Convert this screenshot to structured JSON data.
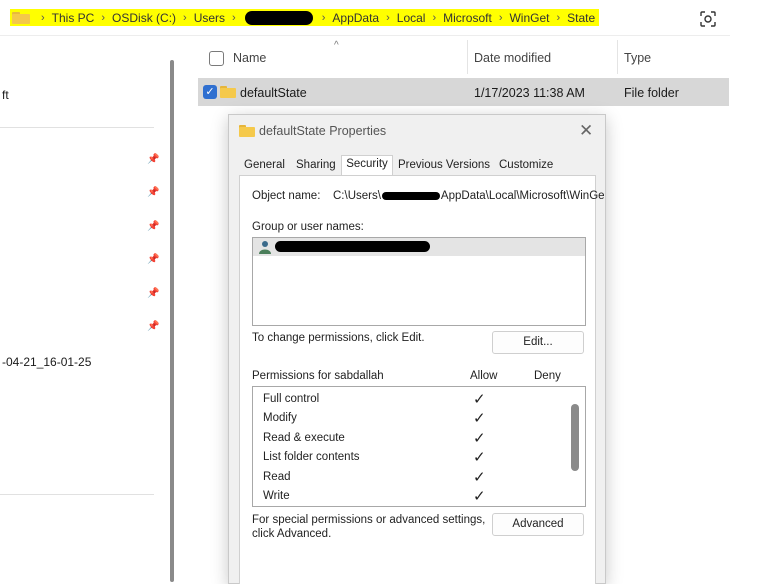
{
  "breadcrumb": {
    "items": [
      "This PC",
      "OSDisk (C:)",
      "Users",
      "AppData",
      "Local",
      "Microsoft",
      "WinGet",
      "State"
    ]
  },
  "left_pane": {
    "text1": "ft",
    "text2": "-04-21_16-01-25"
  },
  "file_list": {
    "headers": {
      "name": "Name",
      "date": "Date modified",
      "type": "Type"
    },
    "row": {
      "name": "defaultState",
      "date": "1/17/2023 11:38 AM",
      "type": "File folder"
    }
  },
  "dialog": {
    "title": "defaultState Properties",
    "tabs": [
      "General",
      "Sharing",
      "Security",
      "Previous Versions",
      "Customize"
    ],
    "object_name_label": "Object name:",
    "object_name_prefix": "C:\\Users\\",
    "object_name_suffix": "AppData\\Local\\Microsoft\\WinGe",
    "group_label": "Group or user names:",
    "change_text": "To change permissions, click Edit.",
    "edit_button": "Edit...",
    "permissions_label": "Permissions for sabdallah",
    "allow_header": "Allow",
    "deny_header": "Deny",
    "permissions": [
      {
        "name": "Full control",
        "allow": "✓"
      },
      {
        "name": "Modify",
        "allow": "✓"
      },
      {
        "name": "Read & execute",
        "allow": "✓"
      },
      {
        "name": "List folder contents",
        "allow": "✓"
      },
      {
        "name": "Read",
        "allow": "✓"
      },
      {
        "name": "Write",
        "allow": "✓"
      }
    ],
    "special_text_1": "For special permissions or advanced settings,",
    "special_text_2": "click Advanced.",
    "advanced_button": "Advanced"
  },
  "colors": {
    "highlight": "#ffff00",
    "selected_row": "#d7d7d7",
    "checkbox_accent": "#2f6fd0"
  }
}
